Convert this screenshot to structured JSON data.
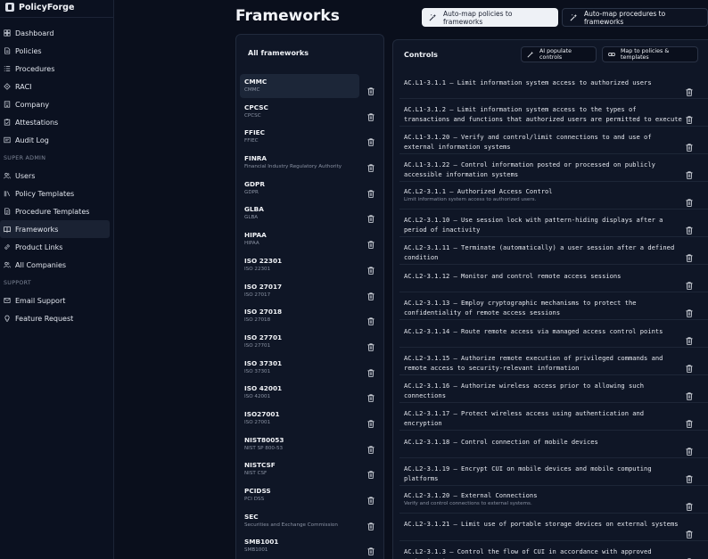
{
  "app": {
    "brand": "PolicyForge"
  },
  "sidebar": {
    "items": [
      {
        "label": "Dashboard",
        "icon": "dashboard-icon"
      },
      {
        "label": "Policies",
        "icon": "document-icon"
      },
      {
        "label": "Procedures",
        "icon": "list-icon"
      },
      {
        "label": "RACI",
        "icon": "matrix-icon"
      },
      {
        "label": "Company",
        "icon": "building-icon"
      },
      {
        "label": "Attestations",
        "icon": "clipboard-icon"
      },
      {
        "label": "Audit Log",
        "icon": "history-icon"
      }
    ],
    "super_admin_label": "SUPER ADMIN",
    "admin_items": [
      {
        "label": "Users",
        "icon": "users-icon"
      },
      {
        "label": "Policy Templates",
        "icon": "library-icon"
      },
      {
        "label": "Procedure Templates",
        "icon": "file-template-icon"
      },
      {
        "label": "Frameworks",
        "icon": "book-icon",
        "active": true
      },
      {
        "label": "Product Links",
        "icon": "link-icon"
      },
      {
        "label": "All Companies",
        "icon": "users-icon"
      }
    ],
    "support_label": "SUPPORT",
    "support_items": [
      {
        "label": "Email Support",
        "icon": "mail-icon"
      },
      {
        "label": "Feature Request",
        "icon": "lightbulb-icon"
      }
    ]
  },
  "header": {
    "title": "Frameworks",
    "automap_policies": "Auto-map policies to frameworks",
    "automap_procedures": "Auto-map procedures to frameworks"
  },
  "frameworks": {
    "title": "All frameworks",
    "items": [
      {
        "name": "CMMC",
        "sub": "CMMC",
        "selected": true
      },
      {
        "name": "CPCSC",
        "sub": "CPCSC"
      },
      {
        "name": "FFIEC",
        "sub": "FFIEC"
      },
      {
        "name": "FINRA",
        "sub": "Financial Industry Regulatory Authority"
      },
      {
        "name": "GDPR",
        "sub": "GDPR"
      },
      {
        "name": "GLBA",
        "sub": "GLBA"
      },
      {
        "name": "HIPAA",
        "sub": "HIPAA"
      },
      {
        "name": "ISO 22301",
        "sub": "ISO 22301"
      },
      {
        "name": "ISO 27017",
        "sub": "ISO 27017"
      },
      {
        "name": "ISO 27018",
        "sub": "ISO 27018"
      },
      {
        "name": "ISO 27701",
        "sub": "ISO 27701"
      },
      {
        "name": "ISO 37301",
        "sub": "ISO 37301"
      },
      {
        "name": "ISO 42001",
        "sub": "ISO 42001"
      },
      {
        "name": "ISO27001",
        "sub": "ISO 27001"
      },
      {
        "name": "NIST80053",
        "sub": "NIST SP 800-53"
      },
      {
        "name": "NISTCSF",
        "sub": "NIST CSF"
      },
      {
        "name": "PCIDSS",
        "sub": "PCI DSS"
      },
      {
        "name": "SEC",
        "sub": "Securities and Exchange Commission"
      },
      {
        "name": "SMB1001",
        "sub": "SMB1001"
      }
    ]
  },
  "controls": {
    "title": "Controls",
    "ai_populate": "AI populate controls",
    "map_to": "Map to policies & templates",
    "items": [
      {
        "text": "AC.L1-3.1.1 – Limit information system access to authorized users",
        "h": 31
      },
      {
        "text": "AC.L1-3.1.2 – Limit information system access to the types of transactions and functions that authorized users are permitted to execute",
        "h": 31
      },
      {
        "text": "AC.L1-3.1.20 – Verify and control/limit connections to and use of external information systems",
        "h": 31
      },
      {
        "text": "AC.L1-3.1.22 – Control information posted or processed on publicly accessible information systems",
        "h": 31
      },
      {
        "text": "AC.L2-3.1.1 – Authorized Access Control",
        "desc": "Limit information system access to authorized users.",
        "h": 31
      },
      {
        "text": "AC.L2-3.1.10 – Use session lock with pattern-hiding displays after a period of inactivity",
        "h": 31
      },
      {
        "text": "AC.L2-3.1.11 – Terminate (automatically) a user session after a defined condition",
        "h": 31
      },
      {
        "text": "AC.L2-3.1.12 – Monitor and control remote access sessions",
        "h": 31
      },
      {
        "text": "AC.L2-3.1.13 – Employ cryptographic mechanisms to protect the confidentiality of remote access sessions",
        "h": 31
      },
      {
        "text": "AC.L2-3.1.14 – Route remote access via managed access control points",
        "h": 31
      },
      {
        "text": "AC.L2-3.1.15 – Authorize remote execution of privileged commands and remote access to security-relevant information",
        "h": 31
      },
      {
        "text": "AC.L2-3.1.16 – Authorize wireless access prior to allowing such connections",
        "h": 31
      },
      {
        "text": "AC.L2-3.1.17 – Protect wireless access using authentication and encryption",
        "h": 31
      },
      {
        "text": "AC.L2-3.1.18 – Control connection of mobile devices",
        "h": 31
      },
      {
        "text": "AC.L2-3.1.19 – Encrypt CUI on mobile devices and mobile computing platforms",
        "h": 31
      },
      {
        "text": "AC.L2-3.1.20 – External Connections",
        "desc": "Verify and control connections to external systems.",
        "h": 31
      },
      {
        "text": "AC.L2-3.1.21 – Limit use of portable storage devices on external systems",
        "h": 31
      },
      {
        "text": "AC.L2-3.1.3 – Control the flow of CUI in accordance with approved authorizations",
        "h": 31
      }
    ]
  }
}
